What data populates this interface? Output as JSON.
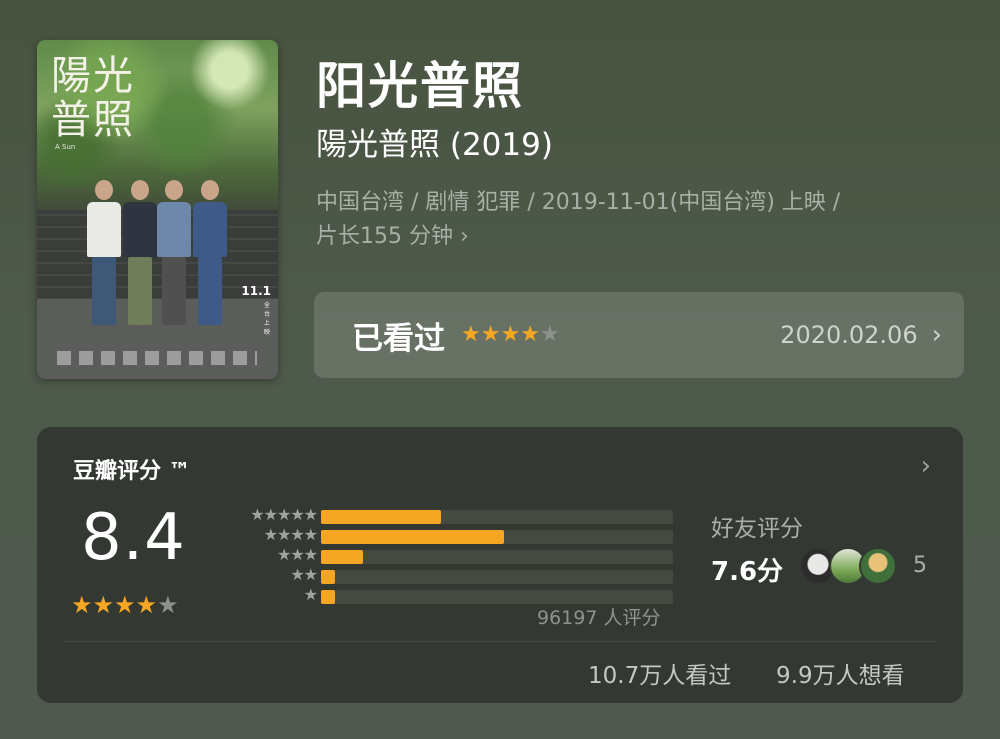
{
  "poster": {
    "title_line1": "陽光",
    "title_line2": "普照",
    "subtitle": "A Sun",
    "release": "11.1",
    "release_sub": "全台上映"
  },
  "movie": {
    "title": "阳光普照",
    "original_title": "陽光普照 (2019)",
    "meta_line1": "中国台湾 / 剧情 犯罪 / 2019-11-01(中国台湾) 上映 /",
    "meta_line2": "片长155 分钟",
    "meta_chevron": "›"
  },
  "watched": {
    "label": "已看过",
    "user_rating": 4,
    "date": "2020.02.06",
    "chevron": "›"
  },
  "rating": {
    "title": "豆瓣评分 ™",
    "chevron": "›",
    "score": "8.4",
    "score_stars": 4,
    "distribution": [
      {
        "stars": "★★★★★",
        "fraction": 0.34
      },
      {
        "stars": "★★★★",
        "fraction": 0.52
      },
      {
        "stars": "★★★",
        "fraction": 0.12
      },
      {
        "stars": "★★",
        "fraction": 0.04
      },
      {
        "stars": "★",
        "fraction": 0.04
      }
    ],
    "count_text": "96197 人评分",
    "friend_label": "好友评分",
    "friend_score": "7.6分",
    "friend_count": "5",
    "seen_text": "10.7万人看过",
    "want_text": "9.9万人想看"
  },
  "colors": {
    "star_on": "#f5a623",
    "star_off": "#8d918c",
    "bar_fill": "#f5a623",
    "card_bg": "#333932"
  }
}
